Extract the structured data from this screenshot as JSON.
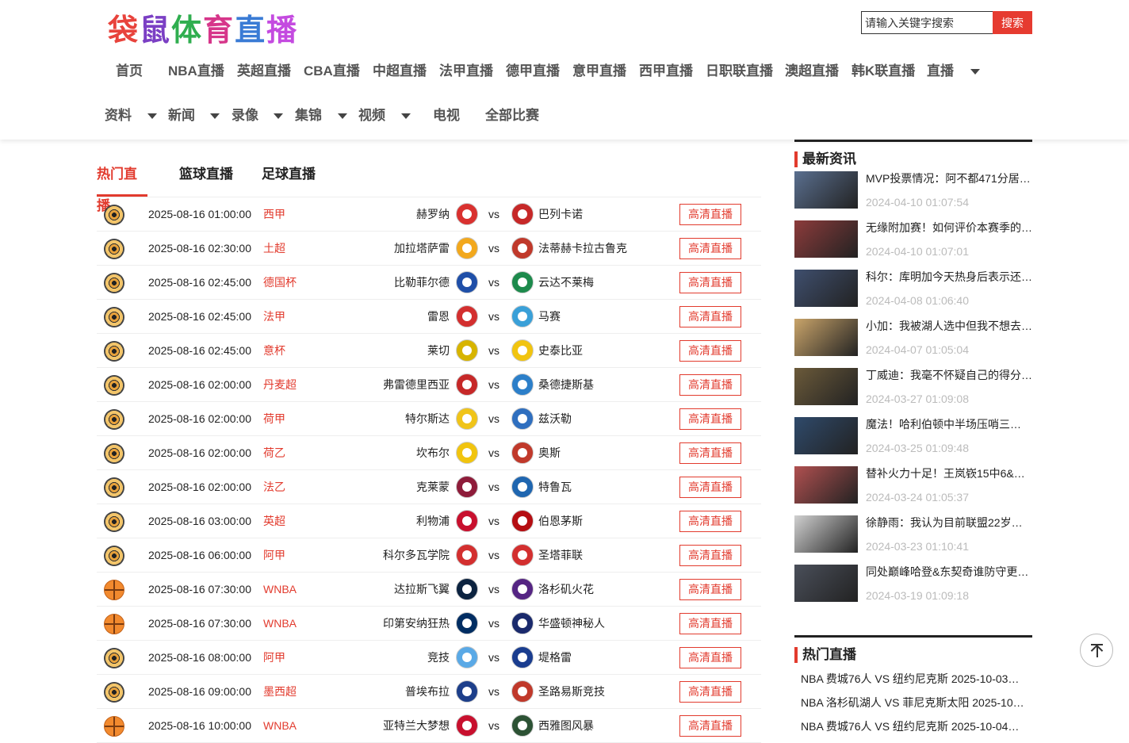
{
  "site": {
    "logo_text": "袋鼠体育直播",
    "search_placeholder": "请输入关键字搜索",
    "search_button": "搜索"
  },
  "nav": {
    "row1": [
      "首页",
      "NBA直播",
      "英超直播",
      "CBA直播",
      "中超直播",
      "法甲直播",
      "德甲直播",
      "意甲直播",
      "西甲直播",
      "日职联直播",
      "澳超直播",
      "韩K联直播",
      "直播"
    ],
    "row2": [
      "资料",
      "新闻",
      "录像",
      "集锦",
      "视频",
      "电视",
      "全部比赛"
    ]
  },
  "tabs": [
    "热门直播",
    "篮球直播",
    "足球直播"
  ],
  "live_button_label": "高清直播",
  "vs_label": "vs",
  "matches": [
    {
      "sport": "football",
      "time": "2025-08-16 01:00:00",
      "league": "西甲",
      "home": "赫罗纳",
      "away": "巴列卡诺",
      "home_color": "#d9312f",
      "away_color": "#c62828"
    },
    {
      "sport": "football",
      "time": "2025-08-16 02:30:00",
      "league": "土超",
      "home": "加拉塔萨雷",
      "away": "法蒂赫卡拉古鲁克",
      "home_color": "#f2a81d",
      "away_color": "#c0392b"
    },
    {
      "sport": "football",
      "time": "2025-08-16 02:45:00",
      "league": "德国杯",
      "home": "比勒菲尔德",
      "away": "云达不莱梅",
      "home_color": "#1f4fa8",
      "away_color": "#1d8a4c"
    },
    {
      "sport": "football",
      "time": "2025-08-16 02:45:00",
      "league": "法甲",
      "home": "雷恩",
      "away": "马赛",
      "home_color": "#d32f2f",
      "away_color": "#3aa0d8"
    },
    {
      "sport": "football",
      "time": "2025-08-16 02:45:00",
      "league": "意杯",
      "home": "莱切",
      "away": "史泰比亚",
      "home_color": "#d7b400",
      "away_color": "#f1c40f"
    },
    {
      "sport": "football",
      "time": "2025-08-16 02:00:00",
      "league": "丹麦超",
      "home": "弗雷德里西亚",
      "away": "桑德捷斯基",
      "home_color": "#c62828",
      "away_color": "#2c7fc9"
    },
    {
      "sport": "football",
      "time": "2025-08-16 02:00:00",
      "league": "荷甲",
      "home": "特尔斯达",
      "away": "兹沃勒",
      "home_color": "#f0c419",
      "away_color": "#2f6fbf"
    },
    {
      "sport": "football",
      "time": "2025-08-16 02:00:00",
      "league": "荷乙",
      "home": "坎布尔",
      "away": "奥斯",
      "home_color": "#f1c40f",
      "away_color": "#c0392b"
    },
    {
      "sport": "football",
      "time": "2025-08-16 02:00:00",
      "league": "法乙",
      "home": "克莱蒙",
      "away": "特鲁瓦",
      "home_color": "#8e1c3a",
      "away_color": "#1f66b0"
    },
    {
      "sport": "football",
      "time": "2025-08-16 03:00:00",
      "league": "英超",
      "home": "利物浦",
      "away": "伯恩茅斯",
      "home_color": "#c8102e",
      "away_color": "#b50e12"
    },
    {
      "sport": "football",
      "time": "2025-08-16 06:00:00",
      "league": "阿甲",
      "home": "科尔多瓦学院",
      "away": "圣塔菲联",
      "home_color": "#d32f2f",
      "away_color": "#d32f2f"
    },
    {
      "sport": "basketball",
      "time": "2025-08-16 07:30:00",
      "league": "WNBA",
      "home": "达拉斯飞翼",
      "away": "洛杉矶火花",
      "home_color": "#0c2340",
      "away_color": "#552583"
    },
    {
      "sport": "basketball",
      "time": "2025-08-16 07:30:00",
      "league": "WNBA",
      "home": "印第安纳狂热",
      "away": "华盛顿神秘人",
      "home_color": "#002d62",
      "away_color": "#1a2a6c"
    },
    {
      "sport": "football",
      "time": "2025-08-16 08:00:00",
      "league": "阿甲",
      "home": "竞技",
      "away": "堤格雷",
      "home_color": "#5aa9e6",
      "away_color": "#1a3d8f"
    },
    {
      "sport": "football",
      "time": "2025-08-16 09:00:00",
      "league": "墨西超",
      "home": "普埃布拉",
      "away": "圣路易斯竞技",
      "home_color": "#1d3f8a",
      "away_color": "#c0392b"
    },
    {
      "sport": "basketball",
      "time": "2025-08-16 10:00:00",
      "league": "WNBA",
      "home": "亚特兰大梦想",
      "away": "西雅图风暴",
      "home_color": "#c8102e",
      "away_color": "#2c5234"
    }
  ],
  "sidebar": {
    "news_title": "最新资讯",
    "news": [
      {
        "title": "MVP投票情况：阿不都471分居…",
        "date": "2024-04-10 01:07:54",
        "color": "#5a6f8f"
      },
      {
        "title": "无缘附加赛！如何评价本赛季的…",
        "date": "2024-04-10 01:07:01",
        "color": "#8c3b3b"
      },
      {
        "title": "科尔：库明加今天热身后表示还…",
        "date": "2024-04-08 01:06:40",
        "color": "#3f4f6e"
      },
      {
        "title": "小加：我被湖人选中但我不想去…",
        "date": "2024-04-07 01:05:04",
        "color": "#c9a46a"
      },
      {
        "title": "丁威迪：我毫不怀疑自己的得分…",
        "date": "2024-03-27 01:09:08",
        "color": "#6b5a3a"
      },
      {
        "title": "魔法！哈利伯顿中半场压哨三…",
        "date": "2024-03-25 01:09:48",
        "color": "#2f4a6b"
      },
      {
        "title": "替补火力十足！王岚嵚15中6&…",
        "date": "2024-03-24 01:05:37",
        "color": "#b05050"
      },
      {
        "title": "徐静雨：我认为目前联盟22岁…",
        "date": "2024-03-23 01:10:41",
        "color": "#d0d0d0"
      },
      {
        "title": "同处巅峰哈登&东契奇谁防守更…",
        "date": "2024-03-19 01:09:18",
        "color": "#4a4f5a"
      }
    ],
    "hot_title": "热门直播",
    "hot": [
      "NBA 费城76人 VS 纽约尼克斯 2025-10-03…",
      "NBA 洛杉矶湖人 VS 菲尼克斯太阳 2025-10-…",
      "NBA 费城76人 VS 纽约尼克斯 2025-10-04…"
    ]
  }
}
